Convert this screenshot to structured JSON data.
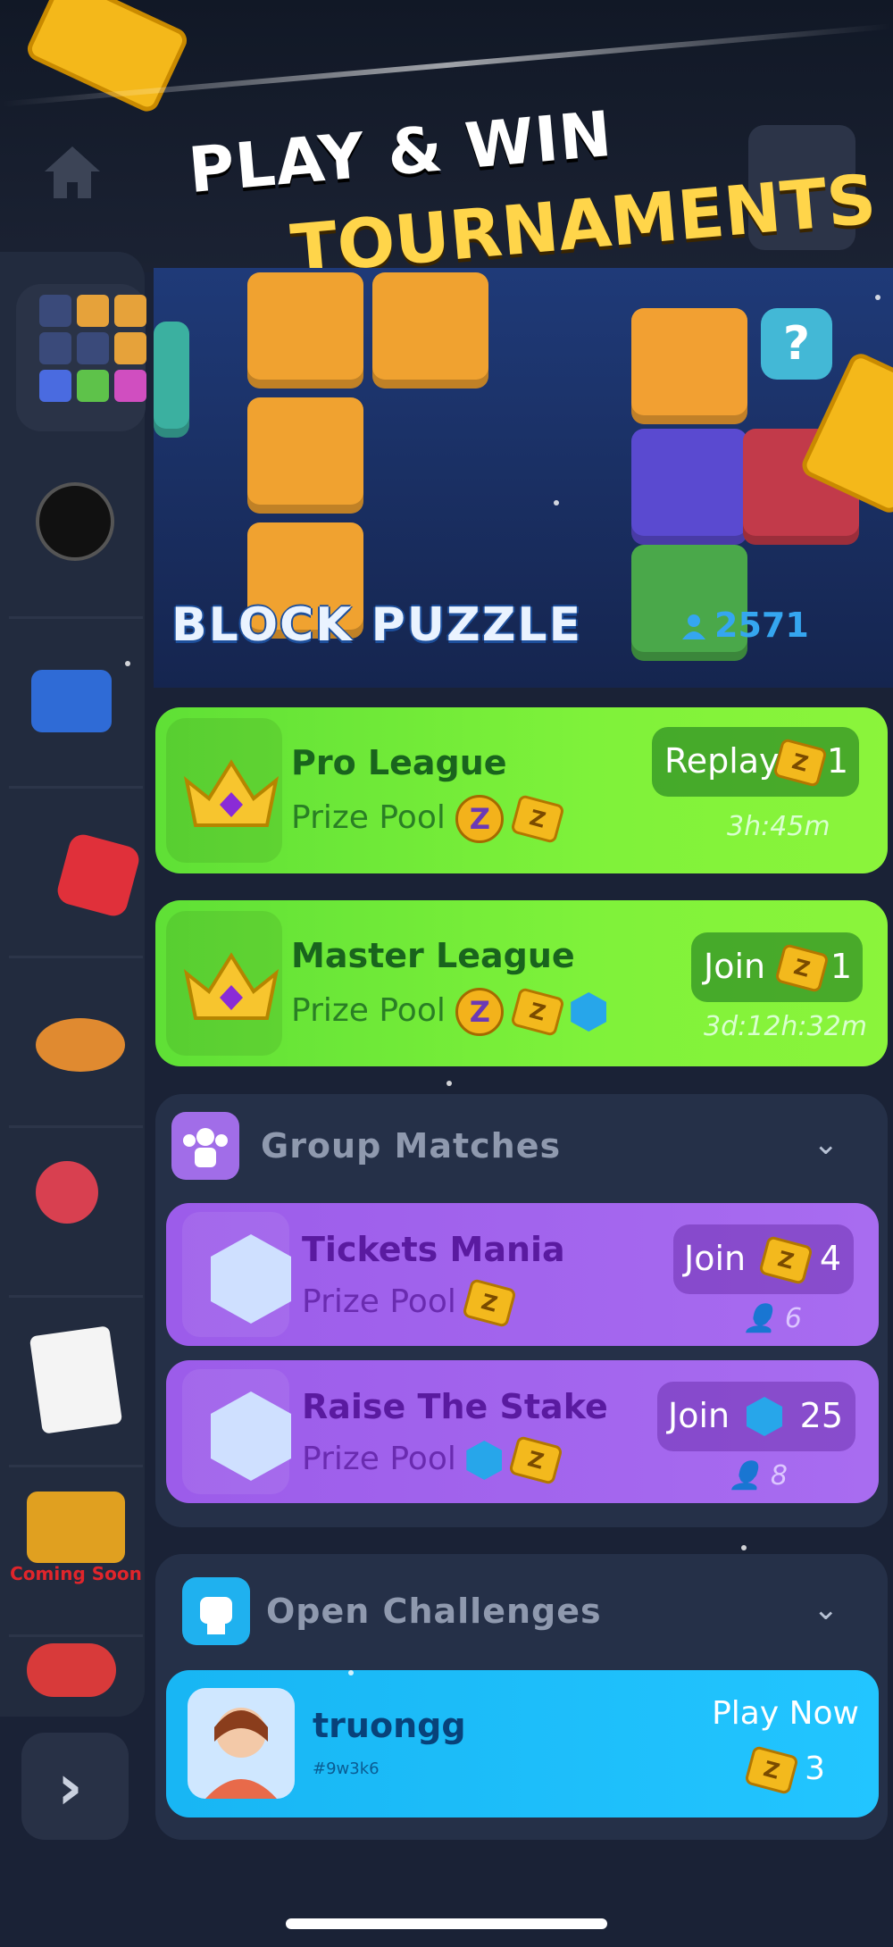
{
  "header": {
    "headline_line1": "PLAY & WIN",
    "headline_line2": "TOURNAMENTS"
  },
  "banner": {
    "game_title": "BLOCK PUZZLE",
    "player_count": "2571",
    "help_symbol": "?"
  },
  "leagues": [
    {
      "name": "Pro League",
      "prize_label": "Prize Pool",
      "button": "Replay",
      "cost": "1",
      "time": "3h:45m"
    },
    {
      "name": "Master League",
      "prize_label": "Prize Pool",
      "button": "Join",
      "cost": "1",
      "time": "3d:12h:32m"
    }
  ],
  "group_matches": {
    "title": "Group Matches",
    "items": [
      {
        "name": "Tickets Mania",
        "prize_label": "Prize Pool",
        "button": "Join",
        "cost": "4",
        "players": "6"
      },
      {
        "name": "Raise The Stake",
        "prize_label": "Prize Pool",
        "button": "Join",
        "cost": "25",
        "players": "8"
      }
    ]
  },
  "open_challenges": {
    "title": "Open Challenges",
    "items": [
      {
        "username": "truongg",
        "tag": "#9w3k6",
        "button": "Play Now",
        "cost": "3"
      }
    ]
  },
  "sidebar": {
    "coming_soon": "Coming Soon",
    "icons": [
      "block-puzzle-icon",
      "billiards-icon",
      "cannon-icon",
      "dice-icon",
      "knockdown-icon",
      "darts-icon",
      "solitaire-icon",
      "tank-icon",
      "slots-icon"
    ]
  },
  "colors": {
    "league_green": "#7ff23a",
    "group_purple": "#a86cf0",
    "challenge_blue": "#22c5ff",
    "headline_yellow": "#ffd54a"
  }
}
